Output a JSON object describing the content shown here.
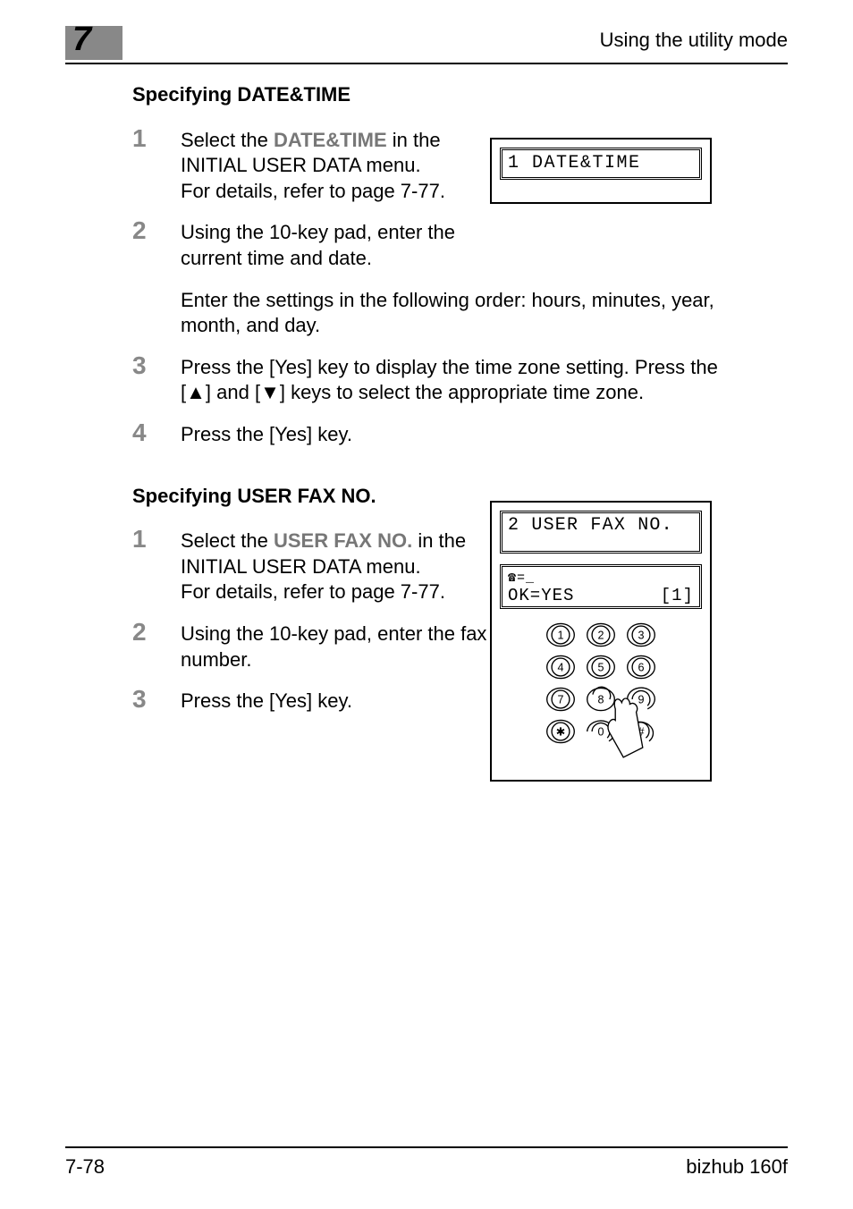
{
  "chapter_number": "7",
  "running_head": "Using the utility mode",
  "section1": {
    "title": "Specifying DATE&TIME",
    "steps": {
      "s1_pre": "Select the ",
      "s1_bold": "DATE&TIME",
      "s1_post": " in the INITIAL USER DATA menu.",
      "s1_line2": "For details, refer to page 7-77.",
      "s2a": "Using the 10-key pad, enter the current time and date.",
      "s2b": "Enter the settings in the following order: hours, minutes, year, month, and day.",
      "s3_pre": "Press the [Yes] key to display the time zone setting. Press the [",
      "s3_tri_up": "▲",
      "s3_mid": "] and [",
      "s3_tri_down": "▼",
      "s3_post": "] keys to select the appropriate time zone.",
      "s4": "Press the [Yes] key."
    },
    "lcd": "1 DATE&TIME"
  },
  "section2": {
    "title": "Specifying USER FAX NO.",
    "steps": {
      "s1_pre": "Select the ",
      "s1_bold": "USER FAX NO.",
      "s1_post": " in the INITIAL USER DATA menu.",
      "s1_line2": "For details, refer to page 7-77.",
      "s2": "Using the 10-key pad, enter the fax number.",
      "s3": "Press the [Yes] key."
    },
    "lcd1": "2 USER FAX NO.",
    "lcd2_line1": "☎=_",
    "lcd2_line2_left": "OK=YES",
    "lcd2_line2_right": "[1]",
    "keypad": {
      "keys": [
        "1",
        "2",
        "3",
        "4",
        "5",
        "6",
        "7",
        "8",
        "9",
        "✱",
        "0",
        "#"
      ]
    }
  },
  "footer": {
    "page": "7-78",
    "product": "bizhub 160f"
  }
}
